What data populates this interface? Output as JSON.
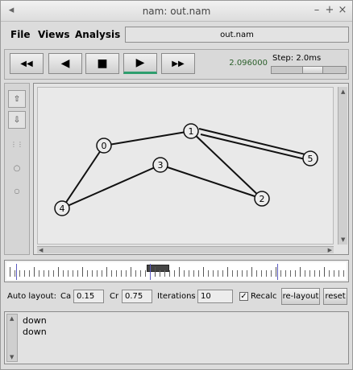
{
  "window": {
    "title": "nam: out.nam"
  },
  "menubar": {
    "items": [
      "File",
      "Views",
      "Analysis"
    ],
    "file_name": "out.nam"
  },
  "controls": {
    "buttons": [
      {
        "name": "rewind-button",
        "icon": "rewind-icon",
        "glyph": "◀◀"
      },
      {
        "name": "step-back-button",
        "icon": "play-back-icon",
        "glyph": "◀"
      },
      {
        "name": "stop-button",
        "icon": "stop-icon",
        "glyph": "■"
      },
      {
        "name": "play-button",
        "icon": "play-icon",
        "glyph": "▶"
      },
      {
        "name": "fast-forward-button",
        "icon": "fast-forward-icon",
        "glyph": "▶▶"
      }
    ],
    "time": "2.096000",
    "step_label": "Step: 2.0ms"
  },
  "network": {
    "nodes": [
      {
        "id": "0"
      },
      {
        "id": "1"
      },
      {
        "id": "2"
      },
      {
        "id": "3"
      },
      {
        "id": "4"
      },
      {
        "id": "5"
      }
    ]
  },
  "layout": {
    "auto_label": "Auto layout:",
    "ca_label": "Ca",
    "ca_value": "0.15",
    "cr_label": "Cr",
    "cr_value": "0.75",
    "iter_label": "Iterations",
    "iter_value": "10",
    "recalc_label": "Recalc",
    "relayout_label": "re-layout",
    "reset_label": "reset"
  },
  "log": {
    "lines": [
      "down",
      "down"
    ]
  },
  "colors": {
    "play_indicator": "#2e9e6e",
    "time_text": "#2a5f2a"
  }
}
